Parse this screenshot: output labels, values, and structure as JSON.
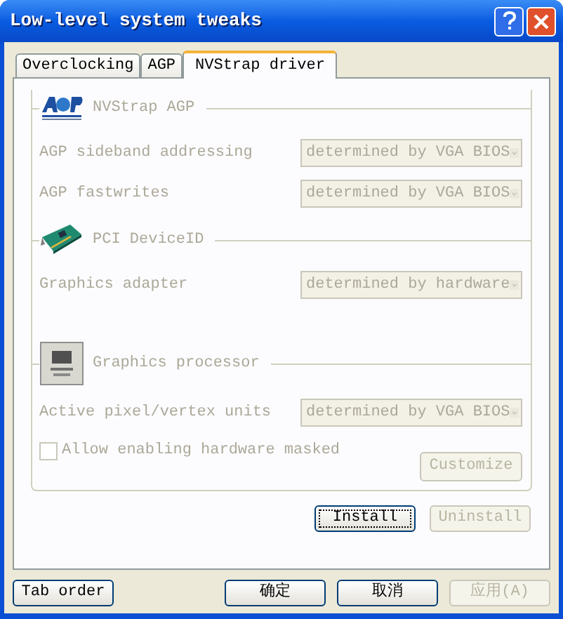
{
  "window": {
    "title": "Low-level system tweaks"
  },
  "tabs": [
    {
      "label": "Overclocking",
      "selected": false
    },
    {
      "label": "AGP",
      "selected": false
    },
    {
      "label": "NVStrap driver",
      "selected": true
    }
  ],
  "sections": [
    {
      "title": "NVStrap AGP",
      "rows": [
        {
          "label": "AGP sideband addressing",
          "value": "determined by VGA BIOS",
          "disabled": true
        },
        {
          "label": "AGP fastwrites",
          "value": "determined by VGA BIOS",
          "disabled": true
        }
      ]
    },
    {
      "title": "PCI DeviceID",
      "rows": [
        {
          "label": "Graphics adapter",
          "value": "determined by hardware",
          "disabled": true
        }
      ]
    },
    {
      "title": "Graphics processor",
      "rows": [
        {
          "label": "Active pixel/vertex units",
          "value": "determined by VGA BIOS",
          "disabled": true
        }
      ]
    }
  ],
  "checkbox": {
    "label": "Allow enabling hardware masked",
    "checked": false,
    "disabled": true
  },
  "customize_button": {
    "label": "Customize",
    "disabled": true
  },
  "driver_buttons": [
    {
      "label": "Install",
      "disabled": false
    },
    {
      "label": "Uninstall",
      "disabled": true
    }
  ],
  "footer_buttons": [
    {
      "label": "Tab order",
      "disabled": false
    },
    {
      "label": "确定",
      "disabled": false
    },
    {
      "label": "取消",
      "disabled": false
    },
    {
      "label": "应用(A)",
      "disabled": true
    }
  ]
}
